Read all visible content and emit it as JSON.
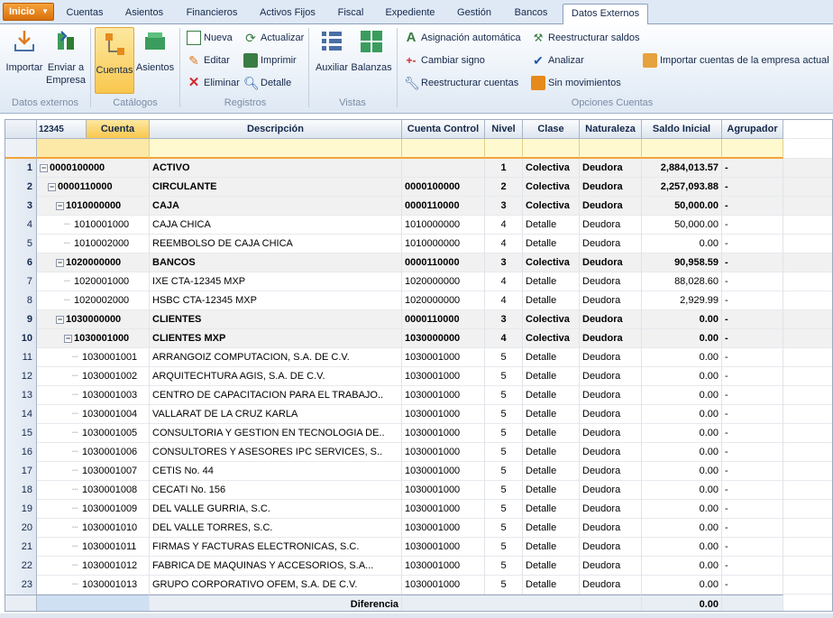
{
  "start_button": "Inicio",
  "tabs": [
    "Cuentas",
    "Asientos",
    "Financieros",
    "Activos Fijos",
    "Fiscal",
    "Expediente",
    "Gestión",
    "Bancos",
    "Datos Externos"
  ],
  "ribbon": {
    "importar": "Importar",
    "enviar": "Enviar a",
    "empresa": "Empresa",
    "cuentas": "Cuentas",
    "asientos": "Asientos",
    "nueva": "Nueva",
    "editar": "Editar",
    "eliminar": "Eliminar",
    "actualizar": "Actualizar",
    "imprimir": "Imprimir",
    "detalle": "Detalle",
    "auxiliar": "Auxiliar",
    "balanzas": "Balanzas",
    "asignacion": "Asignación automática",
    "cambiar_signo": "Cambiar signo",
    "reestructurar_cuentas": "Reestructurar cuentas",
    "reestructurar_saldos": "Reestructurar saldos",
    "analizar": "Analizar",
    "sin_movimientos": "Sin movimientos",
    "importar_cuentas": "Importar cuentas de la empresa actual",
    "groups": {
      "datos_externos": "Datos externos",
      "catalogos": "Catálogos",
      "registros": "Registros",
      "vistas": "Vistas",
      "opciones_cuentas": "Opciones Cuentas"
    }
  },
  "grid": {
    "level_header": "12345",
    "columns": [
      "Cuenta",
      "Descripción",
      "Cuenta Control",
      "Nivel",
      "Clase",
      "Naturaleza",
      "Saldo Inicial",
      "Agrupador"
    ],
    "rows": [
      {
        "n": "1",
        "cuenta": "0000100000",
        "desc": "ACTIVO",
        "control": "",
        "nivel": "1",
        "clase": "Colectiva",
        "nat": "Deudora",
        "saldo": "2,884,013.57",
        "agr": "-",
        "lvl": 0,
        "bold": true
      },
      {
        "n": "2",
        "cuenta": "0000110000",
        "desc": "CIRCULANTE",
        "control": "0000100000",
        "nivel": "2",
        "clase": "Colectiva",
        "nat": "Deudora",
        "saldo": "2,257,093.88",
        "agr": "-",
        "lvl": 1,
        "bold": true
      },
      {
        "n": "3",
        "cuenta": "1010000000",
        "desc": "CAJA",
        "control": "0000110000",
        "nivel": "3",
        "clase": "Colectiva",
        "nat": "Deudora",
        "saldo": "50,000.00",
        "agr": "-",
        "lvl": 2,
        "bold": true
      },
      {
        "n": "4",
        "cuenta": "1010001000",
        "desc": "CAJA CHICA",
        "control": "1010000000",
        "nivel": "4",
        "clase": "Detalle",
        "nat": "Deudora",
        "saldo": "50,000.00",
        "agr": "-",
        "lvl": 3,
        "bold": false
      },
      {
        "n": "5",
        "cuenta": "1010002000",
        "desc": "REEMBOLSO DE CAJA CHICA",
        "control": "1010000000",
        "nivel": "4",
        "clase": "Detalle",
        "nat": "Deudora",
        "saldo": "0.00",
        "agr": "-",
        "lvl": 3,
        "bold": false
      },
      {
        "n": "6",
        "cuenta": "1020000000",
        "desc": "BANCOS",
        "control": "0000110000",
        "nivel": "3",
        "clase": "Colectiva",
        "nat": "Deudora",
        "saldo": "90,958.59",
        "agr": "-",
        "lvl": 2,
        "bold": true
      },
      {
        "n": "7",
        "cuenta": "1020001000",
        "desc": "IXE CTA-12345 MXP",
        "control": "1020000000",
        "nivel": "4",
        "clase": "Detalle",
        "nat": "Deudora",
        "saldo": "88,028.60",
        "agr": "-",
        "lvl": 3,
        "bold": false
      },
      {
        "n": "8",
        "cuenta": "1020002000",
        "desc": "HSBC CTA-12345 MXP",
        "control": "1020000000",
        "nivel": "4",
        "clase": "Detalle",
        "nat": "Deudora",
        "saldo": "2,929.99",
        "agr": "-",
        "lvl": 3,
        "bold": false
      },
      {
        "n": "9",
        "cuenta": "1030000000",
        "desc": "CLIENTES",
        "control": "0000110000",
        "nivel": "3",
        "clase": "Colectiva",
        "nat": "Deudora",
        "saldo": "0.00",
        "agr": "-",
        "lvl": 2,
        "bold": true
      },
      {
        "n": "10",
        "cuenta": "1030001000",
        "desc": "CLIENTES MXP",
        "control": "1030000000",
        "nivel": "4",
        "clase": "Colectiva",
        "nat": "Deudora",
        "saldo": "0.00",
        "agr": "-",
        "lvl": 3,
        "bold": true
      },
      {
        "n": "11",
        "cuenta": "1030001001",
        "desc": "ARRANGOIZ COMPUTACION, S.A. DE C.V.",
        "control": "1030001000",
        "nivel": "5",
        "clase": "Detalle",
        "nat": "Deudora",
        "saldo": "0.00",
        "agr": "-",
        "lvl": 4,
        "bold": false
      },
      {
        "n": "12",
        "cuenta": "1030001002",
        "desc": "ARQUITECHTURA AGIS, S.A. DE C.V.",
        "control": "1030001000",
        "nivel": "5",
        "clase": "Detalle",
        "nat": "Deudora",
        "saldo": "0.00",
        "agr": "-",
        "lvl": 4,
        "bold": false
      },
      {
        "n": "13",
        "cuenta": "1030001003",
        "desc": "CENTRO DE CAPACITACION PARA EL TRABAJO..",
        "control": "1030001000",
        "nivel": "5",
        "clase": "Detalle",
        "nat": "Deudora",
        "saldo": "0.00",
        "agr": "-",
        "lvl": 4,
        "bold": false
      },
      {
        "n": "14",
        "cuenta": "1030001004",
        "desc": "VALLARAT DE LA CRUZ KARLA",
        "control": "1030001000",
        "nivel": "5",
        "clase": "Detalle",
        "nat": "Deudora",
        "saldo": "0.00",
        "agr": "-",
        "lvl": 4,
        "bold": false
      },
      {
        "n": "15",
        "cuenta": "1030001005",
        "desc": "CONSULTORIA Y GESTION EN TECNOLOGIA DE..",
        "control": "1030001000",
        "nivel": "5",
        "clase": "Detalle",
        "nat": "Deudora",
        "saldo": "0.00",
        "agr": "-",
        "lvl": 4,
        "bold": false
      },
      {
        "n": "16",
        "cuenta": "1030001006",
        "desc": "CONSULTORES Y ASESORES IPC SERVICES, S..",
        "control": "1030001000",
        "nivel": "5",
        "clase": "Detalle",
        "nat": "Deudora",
        "saldo": "0.00",
        "agr": "-",
        "lvl": 4,
        "bold": false
      },
      {
        "n": "17",
        "cuenta": "1030001007",
        "desc": "CETIS No. 44",
        "control": "1030001000",
        "nivel": "5",
        "clase": "Detalle",
        "nat": "Deudora",
        "saldo": "0.00",
        "agr": "-",
        "lvl": 4,
        "bold": false
      },
      {
        "n": "18",
        "cuenta": "1030001008",
        "desc": "CECATI No. 156",
        "control": "1030001000",
        "nivel": "5",
        "clase": "Detalle",
        "nat": "Deudora",
        "saldo": "0.00",
        "agr": "-",
        "lvl": 4,
        "bold": false
      },
      {
        "n": "19",
        "cuenta": "1030001009",
        "desc": "DEL VALLE GURRIA, S.C.",
        "control": "1030001000",
        "nivel": "5",
        "clase": "Detalle",
        "nat": "Deudora",
        "saldo": "0.00",
        "agr": "-",
        "lvl": 4,
        "bold": false
      },
      {
        "n": "20",
        "cuenta": "1030001010",
        "desc": "DEL VALLE TORRES, S.C.",
        "control": "1030001000",
        "nivel": "5",
        "clase": "Detalle",
        "nat": "Deudora",
        "saldo": "0.00",
        "agr": "-",
        "lvl": 4,
        "bold": false
      },
      {
        "n": "21",
        "cuenta": "1030001011",
        "desc": "FIRMAS Y FACTURAS ELECTRONICAS, S.C.",
        "control": "1030001000",
        "nivel": "5",
        "clase": "Detalle",
        "nat": "Deudora",
        "saldo": "0.00",
        "agr": "-",
        "lvl": 4,
        "bold": false
      },
      {
        "n": "22",
        "cuenta": "1030001012",
        "desc": "FABRICA DE MAQUINAS Y ACCESORIOS, S.A...",
        "control": "1030001000",
        "nivel": "5",
        "clase": "Detalle",
        "nat": "Deudora",
        "saldo": "0.00",
        "agr": "-",
        "lvl": 4,
        "bold": false
      },
      {
        "n": "23",
        "cuenta": "1030001013",
        "desc": "GRUPO CORPORATIVO OFEM, S.A. DE C.V.",
        "control": "1030001000",
        "nivel": "5",
        "clase": "Detalle",
        "nat": "Deudora",
        "saldo": "0.00",
        "agr": "-",
        "lvl": 4,
        "bold": false
      }
    ],
    "footer": {
      "label": "Diferencia",
      "value": "0.00"
    }
  }
}
